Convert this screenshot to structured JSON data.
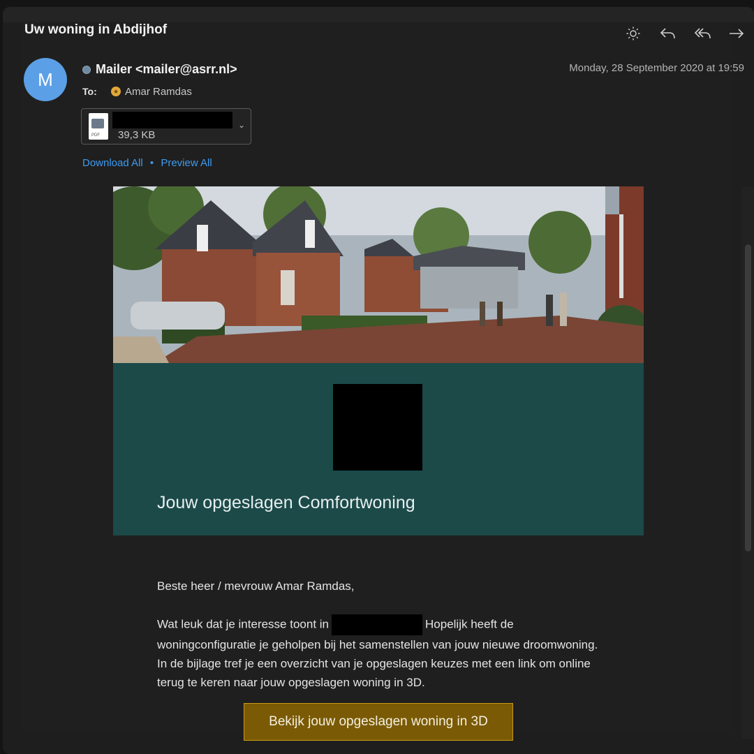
{
  "email": {
    "subject": "Uw woning in Abdijhof",
    "sender_initial": "M",
    "sender": "Mailer <mailer@asrr.nl>",
    "date": "Monday, 28 September 2020 at 19:59",
    "to_label": "To:",
    "recipient": "Amar Ramdas"
  },
  "toolbar": {
    "icons": [
      "brightness-icon",
      "reply-icon",
      "reply-all-icon",
      "forward-icon"
    ]
  },
  "attachment": {
    "file_type": "PDF",
    "size": "39,3 KB"
  },
  "attachment_actions": {
    "download_all": "Download All",
    "separator": "•",
    "preview_all": "Preview All"
  },
  "message": {
    "panel_title": "Jouw opgeslagen Comfortwoning",
    "greeting": "Beste heer / mevrouw Amar Ramdas,",
    "para_before": "Wat leuk dat je interesse toont in",
    "para_after": "Hopelijk heeft de woningconfiguratie je geholpen bij het samenstellen van jouw nieuwe droomwoning. In de bijlage tref je een overzicht van je opgeslagen keuzes met een link om online terug te keren naar jouw opgeslagen woning in 3D.",
    "cta": "Bekijk jouw opgeslagen woning in 3D"
  },
  "colors": {
    "panel": "#1b4a49",
    "cta_bg": "#7a5a05",
    "cta_border": "#c79c15",
    "link": "#3e9bf0",
    "avatar": "#5b9fe6"
  }
}
